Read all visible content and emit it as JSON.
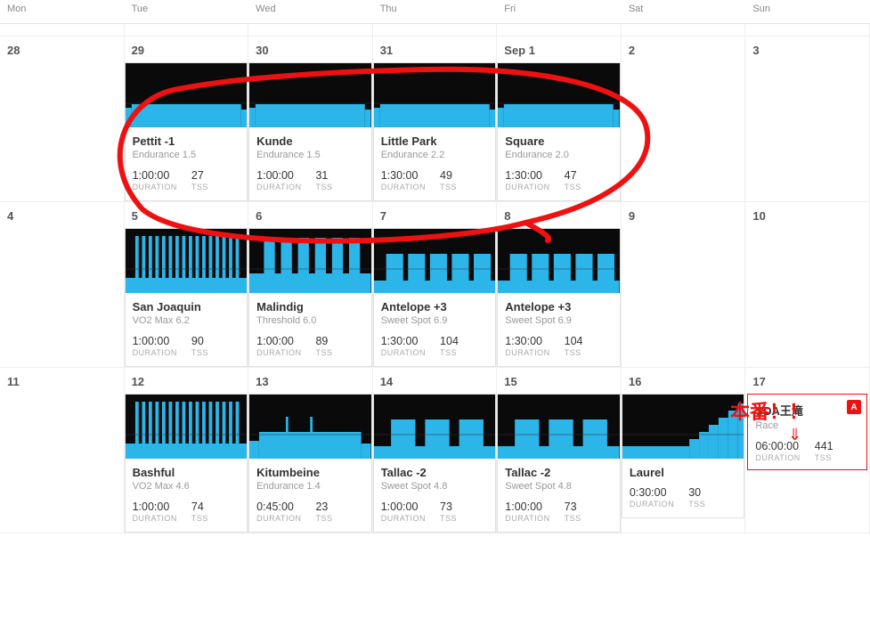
{
  "headers": [
    "Mon",
    "Tue",
    "Wed",
    "Thu",
    "Fri",
    "Sat",
    "Sun"
  ],
  "labels": {
    "duration": "DURATION",
    "tss": "TSS"
  },
  "annotations": {
    "main_text": "本番！！"
  },
  "weeks": [
    {
      "days": [
        {
          "num": "28"
        },
        {
          "num": "29",
          "workout": {
            "name": "Pettit -1",
            "sub": "Endurance 1.5",
            "duration": "1:00:00",
            "tss": "27",
            "profile": "endurance-flat"
          }
        },
        {
          "num": "30",
          "workout": {
            "name": "Kunde",
            "sub": "Endurance 1.5",
            "duration": "1:00:00",
            "tss": "31",
            "profile": "endurance-flat"
          }
        },
        {
          "num": "31",
          "workout": {
            "name": "Little Park",
            "sub": "Endurance 2.2",
            "duration": "1:30:00",
            "tss": "49",
            "profile": "endurance-flat"
          }
        },
        {
          "num": "Sep  1",
          "workout": {
            "name": "Square",
            "sub": "Endurance 2.0",
            "duration": "1:30:00",
            "tss": "47",
            "profile": "endurance-flat"
          }
        },
        {
          "num": "2"
        },
        {
          "num": "3"
        }
      ]
    },
    {
      "days": [
        {
          "num": "4"
        },
        {
          "num": "5",
          "workout": {
            "name": "San Joaquin",
            "sub": "VO2 Max 6.2",
            "duration": "1:00:00",
            "tss": "90",
            "profile": "vo2-bars"
          }
        },
        {
          "num": "6",
          "workout": {
            "name": "Malindig",
            "sub": "Threshold 6.0",
            "duration": "1:00:00",
            "tss": "89",
            "profile": "threshold-bars"
          }
        },
        {
          "num": "7",
          "workout": {
            "name": "Antelope +3",
            "sub": "Sweet Spot 6.9",
            "duration": "1:30:00",
            "tss": "104",
            "profile": "sweetspot-blocks"
          }
        },
        {
          "num": "8",
          "workout": {
            "name": "Antelope +3",
            "sub": "Sweet Spot 6.9",
            "duration": "1:30:00",
            "tss": "104",
            "profile": "sweetspot-blocks"
          }
        },
        {
          "num": "9"
        },
        {
          "num": "10"
        }
      ]
    },
    {
      "days": [
        {
          "num": "11"
        },
        {
          "num": "12",
          "workout": {
            "name": "Bashful",
            "sub": "VO2 Max 4.6",
            "duration": "1:00:00",
            "tss": "74",
            "profile": "vo2-bars"
          }
        },
        {
          "num": "13",
          "workout": {
            "name": "Kitumbeine",
            "sub": "Endurance 1.4",
            "duration": "0:45:00",
            "tss": "23",
            "profile": "endurance-short"
          }
        },
        {
          "num": "14",
          "workout": {
            "name": "Tallac -2",
            "sub": "Sweet Spot 4.8",
            "duration": "1:00:00",
            "tss": "73",
            "profile": "sweetspot-3blocks"
          }
        },
        {
          "num": "15",
          "workout": {
            "name": "Tallac -2",
            "sub": "Sweet Spot 4.8",
            "duration": "1:00:00",
            "tss": "73",
            "profile": "sweetspot-3blocks"
          }
        },
        {
          "num": "16",
          "simple": {
            "name": "Laurel",
            "duration": "0:30:00",
            "tss": "30",
            "profile": "ramp"
          }
        },
        {
          "num": "17",
          "race": {
            "name": "SDA王滝",
            "sub": "Race",
            "duration": "06:00:00",
            "tss": "441",
            "badge": "A"
          }
        }
      ]
    }
  ]
}
